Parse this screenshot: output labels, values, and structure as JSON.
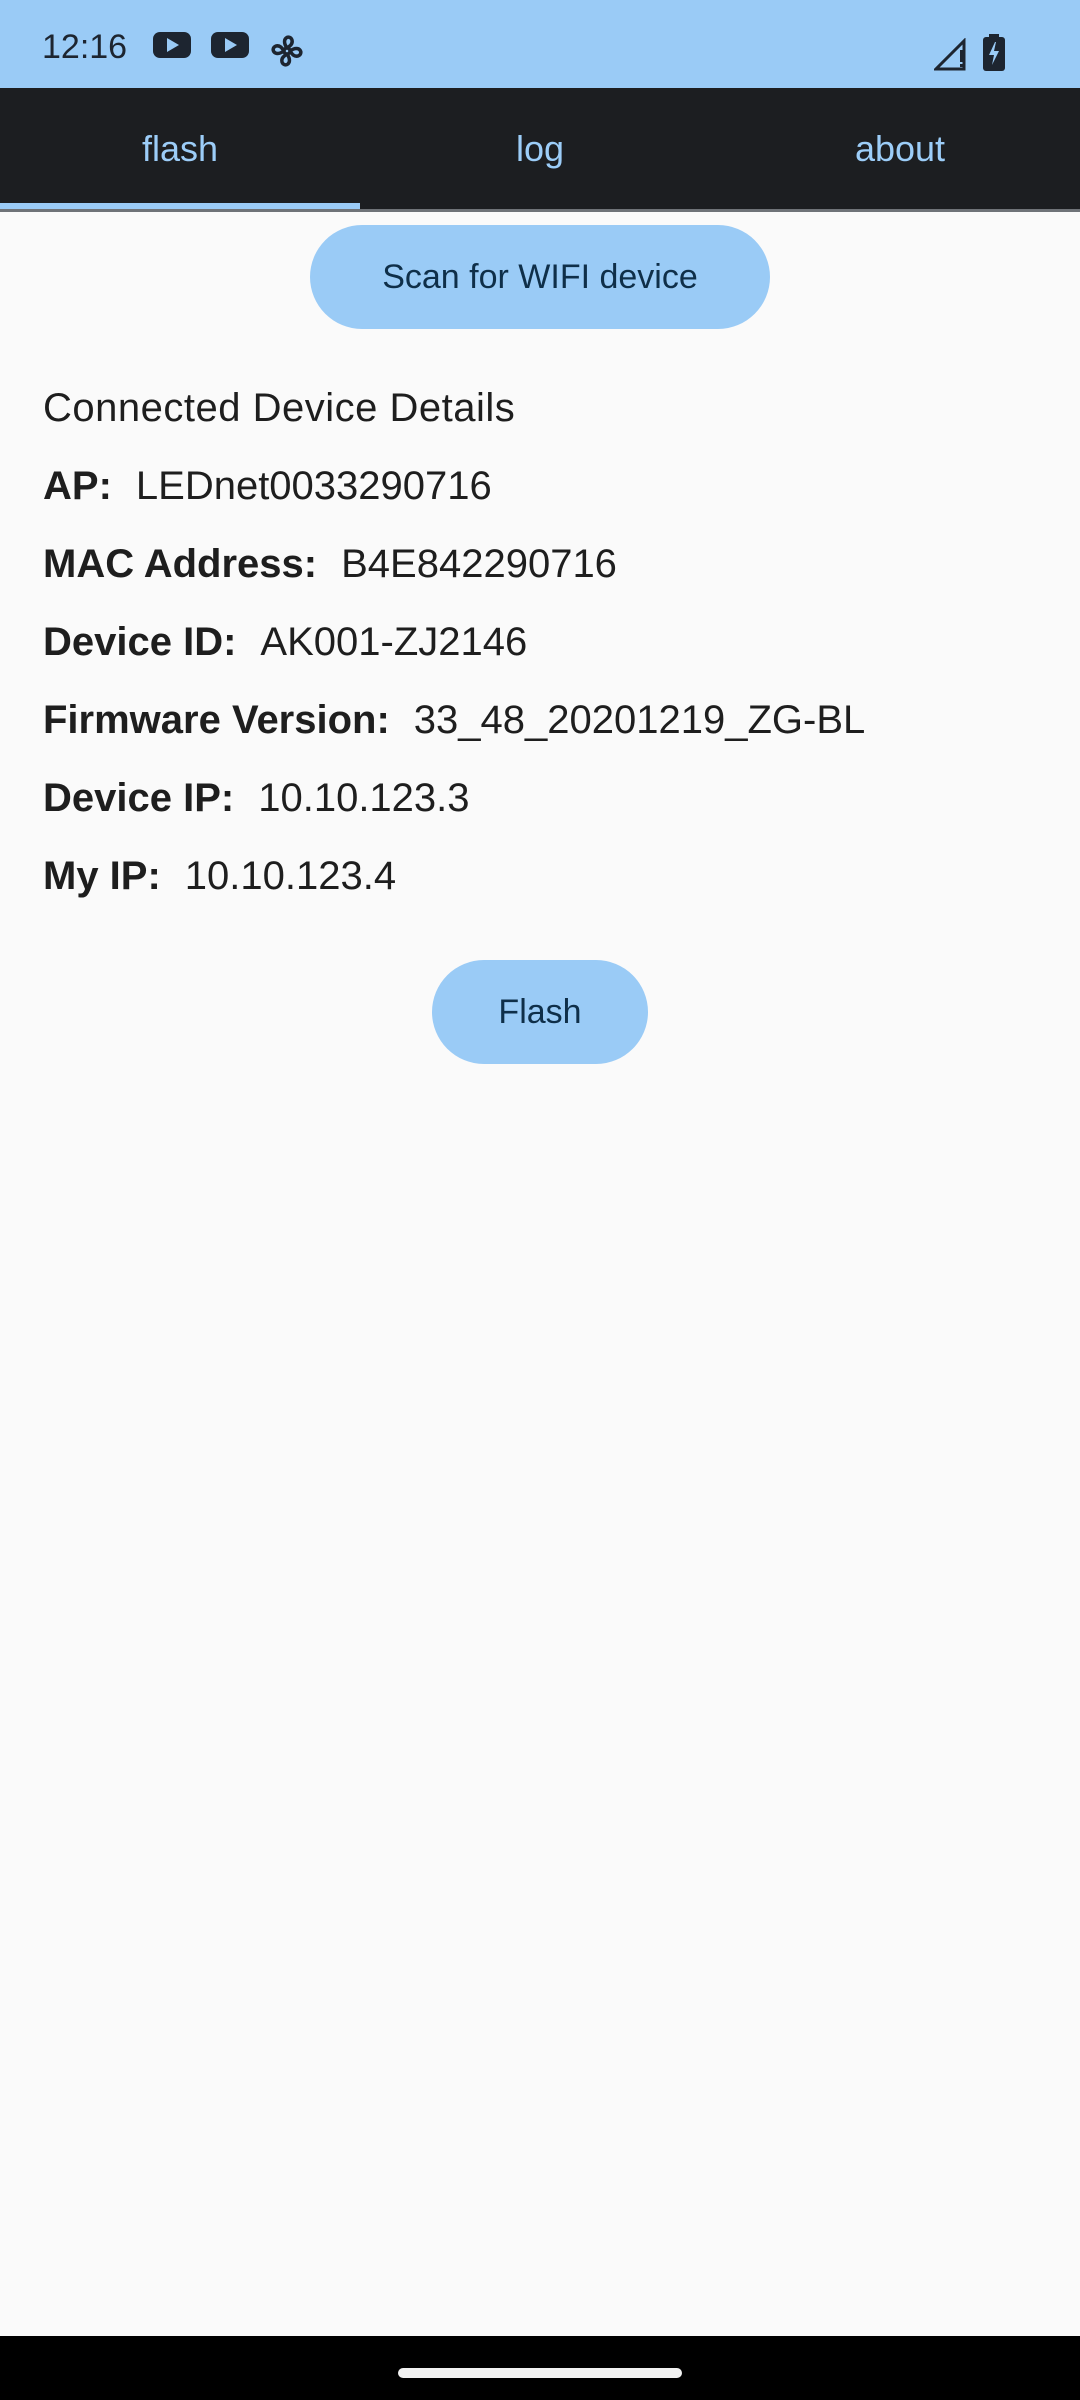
{
  "status_bar": {
    "time": "12:16",
    "icons": [
      "youtube-icon",
      "youtube-icon",
      "fan-icon"
    ],
    "right_icons": [
      "signal-icon",
      "battery-charging-icon"
    ]
  },
  "tabs": [
    {
      "label": "flash",
      "active": true
    },
    {
      "label": "log",
      "active": false
    },
    {
      "label": "about",
      "active": false
    }
  ],
  "scan_button": {
    "label": "Scan for WIFI device"
  },
  "details": {
    "title": "Connected Device Details",
    "rows": [
      {
        "label": "AP:",
        "value": "LEDnet0033290716"
      },
      {
        "label": "MAC Address:",
        "value": "B4E842290716"
      },
      {
        "label": "Device ID:",
        "value": "AK001-ZJ2146"
      },
      {
        "label": "Firmware Version:",
        "value": "33_48_20201219_ZG-BL"
      },
      {
        "label": "Device IP:",
        "value": "10.10.123.3"
      },
      {
        "label": "My IP:",
        "value": "10.10.123.4"
      }
    ]
  },
  "flash_button": {
    "label": "Flash"
  },
  "colors": {
    "accent": "#9acbf6",
    "tab_bar": "#1c1e21",
    "background": "#fafafa"
  }
}
